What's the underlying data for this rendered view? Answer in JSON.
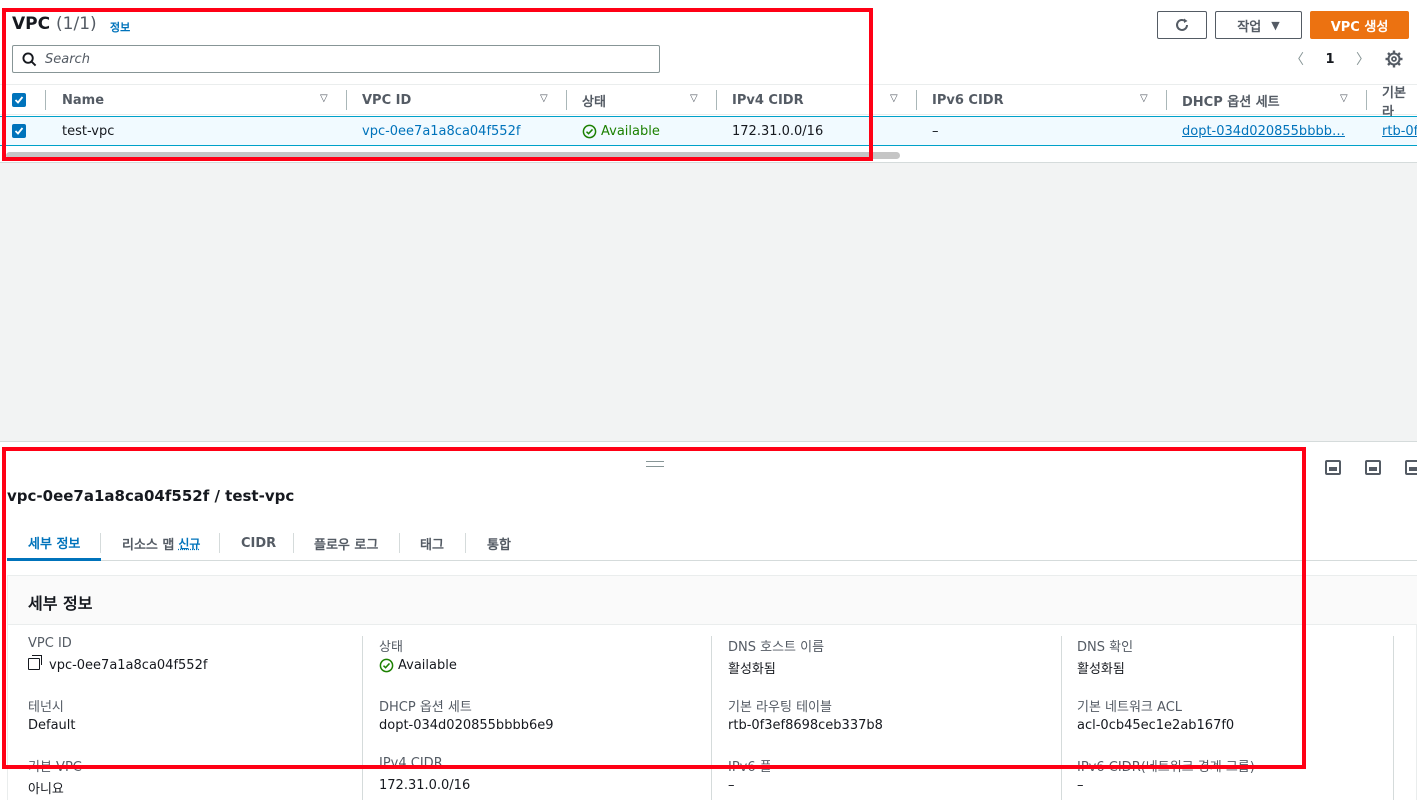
{
  "header": {
    "title": "VPC",
    "count": "(1/1)",
    "info_link": "정보",
    "action_label": "작업",
    "create_label": "VPC 생성",
    "search_placeholder": "Search",
    "page_number": "1"
  },
  "table": {
    "columns": [
      "Name",
      "VPC ID",
      "상태",
      "IPv4 CIDR",
      "IPv6 CIDR",
      "DHCP 옵션 세트",
      "기본 라"
    ],
    "rows": [
      {
        "name": "test-vpc",
        "vpc_id": "vpc-0ee7a1a8ca04f552f",
        "status": "Available",
        "ipv4_cidr": "172.31.0.0/16",
        "ipv6_cidr": "–",
        "dhcp": "dopt-034d020855bbbb…",
        "route_table": "rtb-0f"
      }
    ]
  },
  "panel": {
    "title": "vpc-0ee7a1a8ca04f552f / test-vpc",
    "tabs": [
      "세부 정보",
      "리소스 맵",
      "CIDR",
      "플로우 로그",
      "태그",
      "통합"
    ],
    "new_badge": "신규",
    "details_title": "세부 정보",
    "details": [
      [
        {
          "label": "VPC ID",
          "value": "vpc-0ee7a1a8ca04f552f"
        },
        {
          "label": "테넌시",
          "value": "Default"
        },
        {
          "label": "기본 VPC",
          "value": "아니요"
        }
      ],
      [
        {
          "label": "상태",
          "value": "Available"
        },
        {
          "label": "DHCP 옵션 세트",
          "value": "dopt-034d020855bbbb6e9"
        },
        {
          "label": "IPv4 CIDR",
          "value": "172.31.0.0/16"
        }
      ],
      [
        {
          "label": "DNS 호스트 이름",
          "value": "활성화됨"
        },
        {
          "label": "기본 라우팅 테이블",
          "value": "rtb-0f3ef8698ceb337b8"
        },
        {
          "label": "IPv6 풀",
          "value": "–"
        }
      ],
      [
        {
          "label": "DNS 확인",
          "value": "활성화됨"
        },
        {
          "label": "기본 네트워크 ACL",
          "value": "acl-0cb45ec1e2ab167f0"
        },
        {
          "label": "IPv6 CIDR(네트워크 경계 그룹)",
          "value": "–"
        }
      ]
    ]
  },
  "colors": {
    "accent": "#0073bb",
    "primary_button": "#ec7211",
    "success": "#1d8102",
    "highlight_box": "#ff0015"
  }
}
